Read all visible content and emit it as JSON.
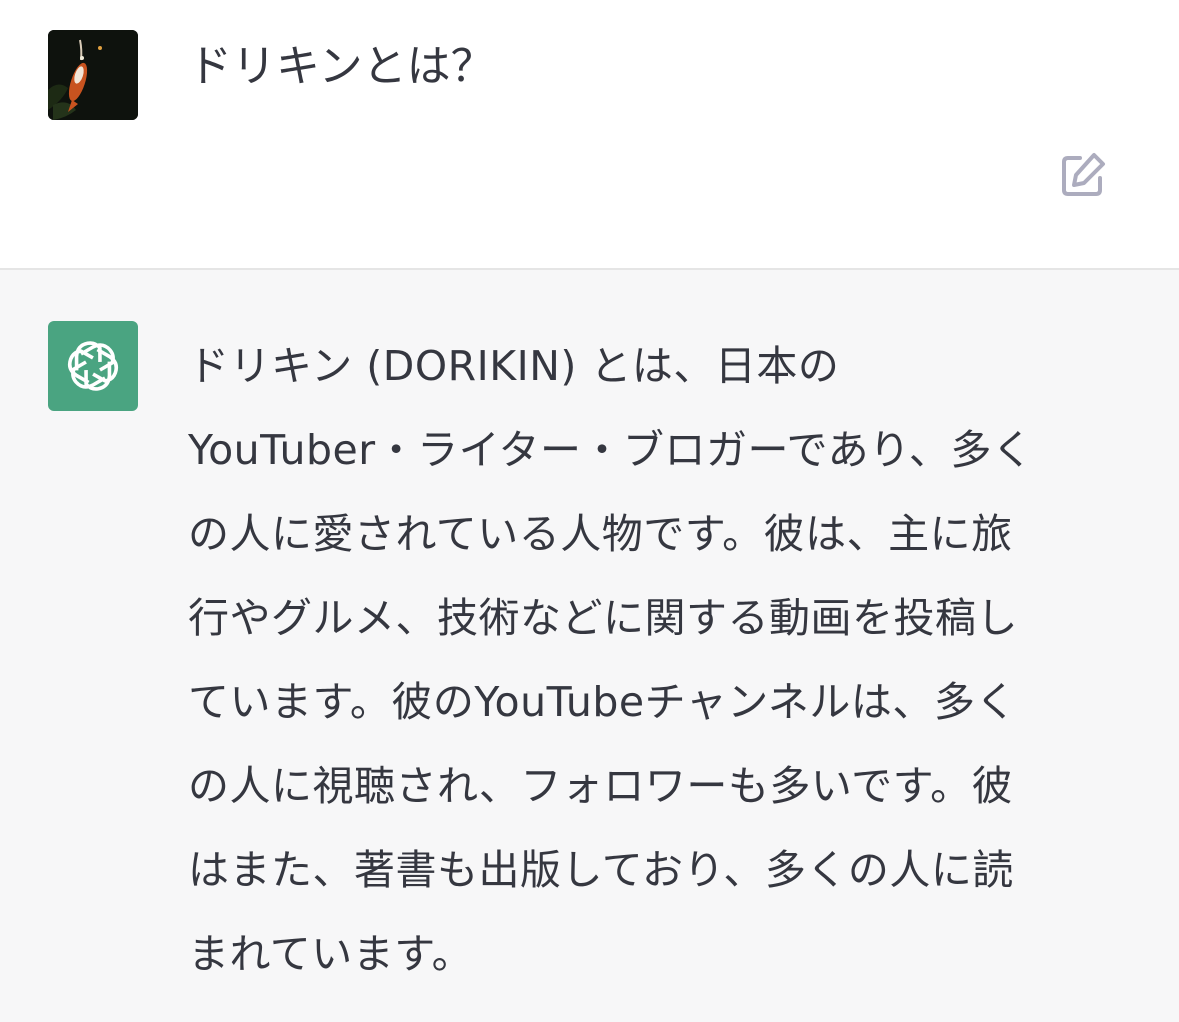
{
  "user_message": {
    "avatar": "koi-fish-photo-avatar",
    "text": "ドリキンとは？",
    "edit_icon": "pencil-square-icon"
  },
  "assistant_message": {
    "avatar": "openai-logo-icon",
    "lines": [
      "ドリキン (DORIKIN) とは、日本の",
      "YouTuber・ライター・ブロガーであり、多く",
      "の人に愛されている人物です。彼は、主に旅",
      "行やグルメ、技術などに関する動画を投稿し",
      "ています。彼のYouTubeチャンネルは、多く",
      "の人に視聴され、フォロワーも多いです。彼",
      "はまた、著書も出版しており、多くの人に読",
      "まれています。"
    ]
  },
  "colors": {
    "text": "#353740",
    "assistant_bg": "#f7f7f8",
    "bot_avatar_bg": "#4aa481",
    "icon_gray": "#acacbe"
  }
}
